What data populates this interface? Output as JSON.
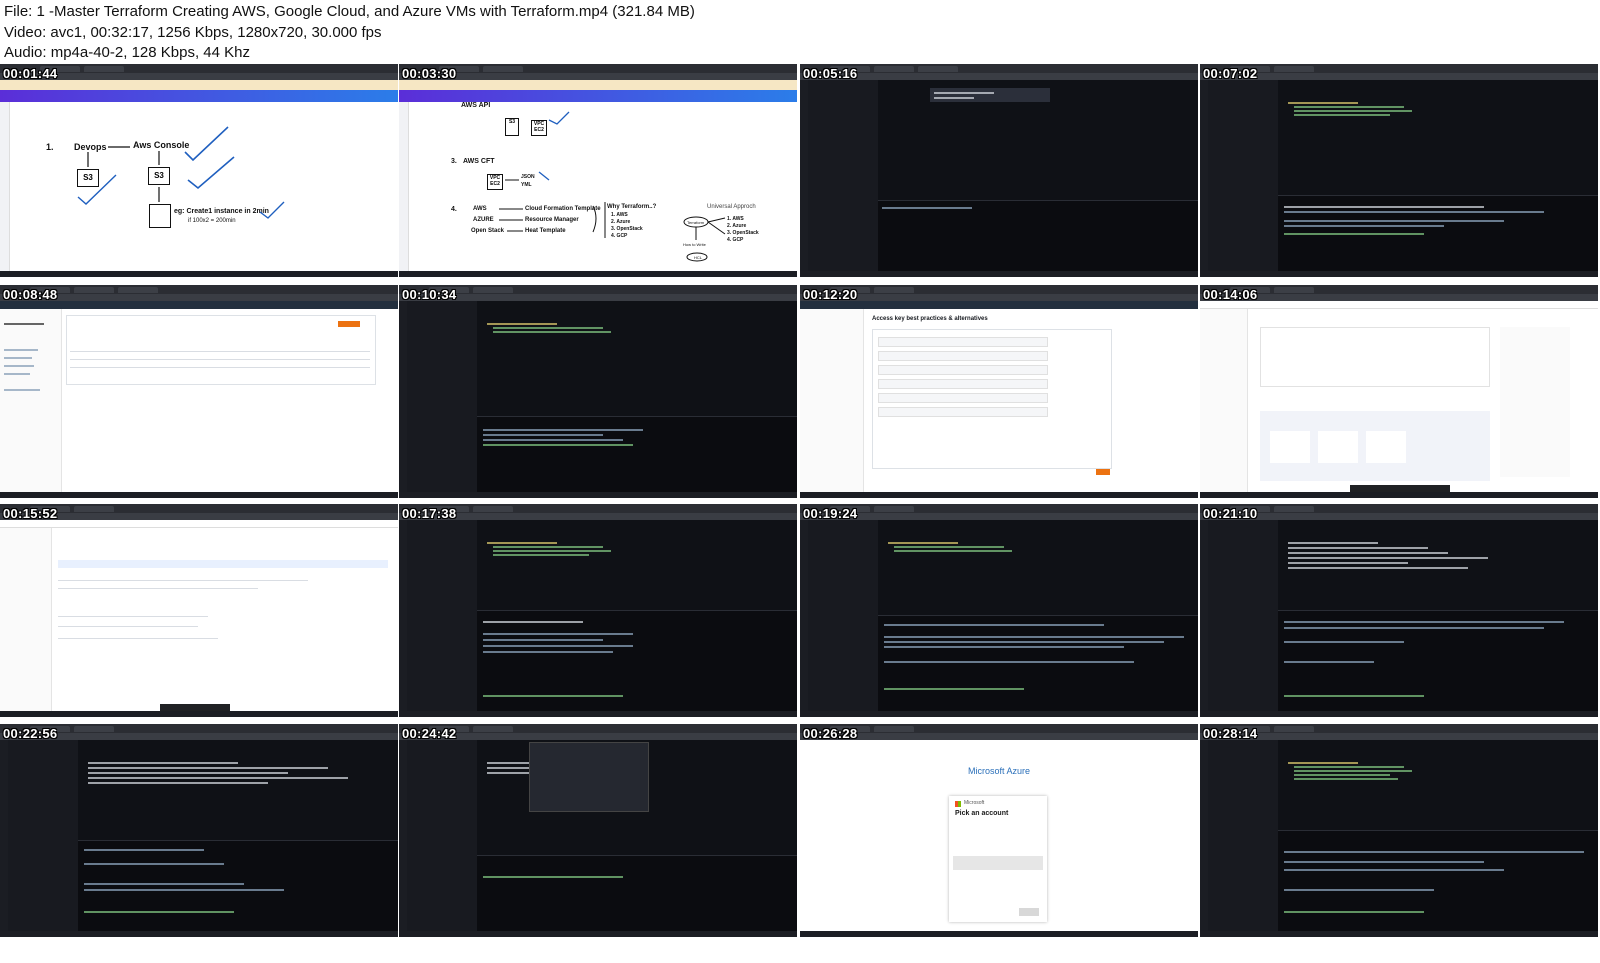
{
  "header": {
    "file_line": "File: 1 -Master Terraform Creating AWS, Google Cloud, and Azure VMs with Terraform.mp4 (321.84 MB)",
    "video_line": "Video: avc1, 00:32:17, 1256 Kbps, 1280x720, 30.000 fps",
    "audio_line": "Audio: mp4a-40-2, 128 Kbps, 44 Khz"
  },
  "thumbnails": [
    {
      "time": "00:01:44",
      "kind": "whiteboard-devops"
    },
    {
      "time": "00:03:30",
      "kind": "whiteboard-terraform"
    },
    {
      "time": "00:05:16",
      "kind": "vscode-empty"
    },
    {
      "time": "00:07:02",
      "kind": "vscode"
    },
    {
      "time": "00:08:48",
      "kind": "aws-iam"
    },
    {
      "time": "00:10:34",
      "kind": "vscode"
    },
    {
      "time": "00:12:20",
      "kind": "aws-access-keys"
    },
    {
      "time": "00:14:06",
      "kind": "google-cloud"
    },
    {
      "time": "00:15:52",
      "kind": "google-cloud-keys"
    },
    {
      "time": "00:17:38",
      "kind": "vscode"
    },
    {
      "time": "00:19:24",
      "kind": "vscode"
    },
    {
      "time": "00:21:10",
      "kind": "vscode"
    },
    {
      "time": "00:22:56",
      "kind": "vscode"
    },
    {
      "time": "00:24:42",
      "kind": "vscode-menu"
    },
    {
      "time": "00:26:28",
      "kind": "azure-login"
    },
    {
      "time": "00:28:14",
      "kind": "vscode"
    }
  ],
  "whiteboard1": {
    "num": "1.",
    "devops": "Devops",
    "console": "Aws Console",
    "s3a": "S3",
    "s3b": "S3",
    "eg": "eg: Create1 instance in 2min",
    "eg2": "if 100x2 = 200min"
  },
  "whiteboard2": {
    "api": "AWS API",
    "s3": "S3",
    "vpc": "VPC",
    "ec2": "EC2",
    "num3": "3.",
    "cft": "AWS CFT",
    "vpc2": "VPC",
    "ec2b": "EC2",
    "json": "JSON",
    "yml": "YML",
    "num4": "4.",
    "aws": "AWS",
    "azure": "AZURE",
    "openstack": "Open Stack",
    "cf": "Cloud Formation Template",
    "rm": "Resource Manager",
    "ht": "Heat Template",
    "why": "Why Terraform..?",
    "why_list": [
      "1. AWS",
      "2. Azure",
      "3. OpenStack",
      "4. GCP"
    ],
    "universal": "Universal Approch",
    "terraform": "Terraform",
    "how": "How to Write",
    "hcl": "HCL",
    "uni_list": [
      "1. AWS",
      "2. Azure",
      "3. OpenStack",
      "4. GCP"
    ]
  },
  "aws_keys": {
    "title": "Access key best practices & alternatives"
  },
  "azure": {
    "title": "Microsoft Azure",
    "ms": "Microsoft",
    "pick": "Pick an account"
  }
}
